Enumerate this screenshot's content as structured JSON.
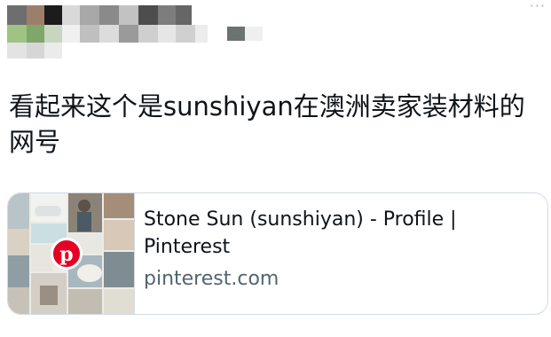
{
  "post": {
    "text": "看起来这个是sunshiyan在澳洲卖家装材料的网号"
  },
  "link_card": {
    "title": "Stone Sun (sunshiyan) - Profile | Pinterest",
    "domain": "pinterest.com"
  },
  "icons": {
    "more": "more-icon",
    "pinterest": "pinterest-logo-icon"
  },
  "colors": {
    "text": "#0f1419",
    "secondary_text": "#536471",
    "border": "#d3dbe1",
    "pinterest_red": "#e60023"
  }
}
